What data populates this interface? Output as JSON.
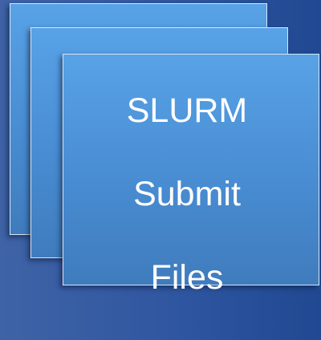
{
  "diagram": {
    "stack_label_lines": [
      "SLURM",
      "Submit",
      "Files"
    ],
    "colors": {
      "background": "#2f56a0",
      "card_fill_top": "#58a2e6",
      "card_fill_bottom": "#3f7cbd",
      "card_border": "#d8e6f5",
      "text": "#ffffff"
    },
    "card_count": 3
  }
}
